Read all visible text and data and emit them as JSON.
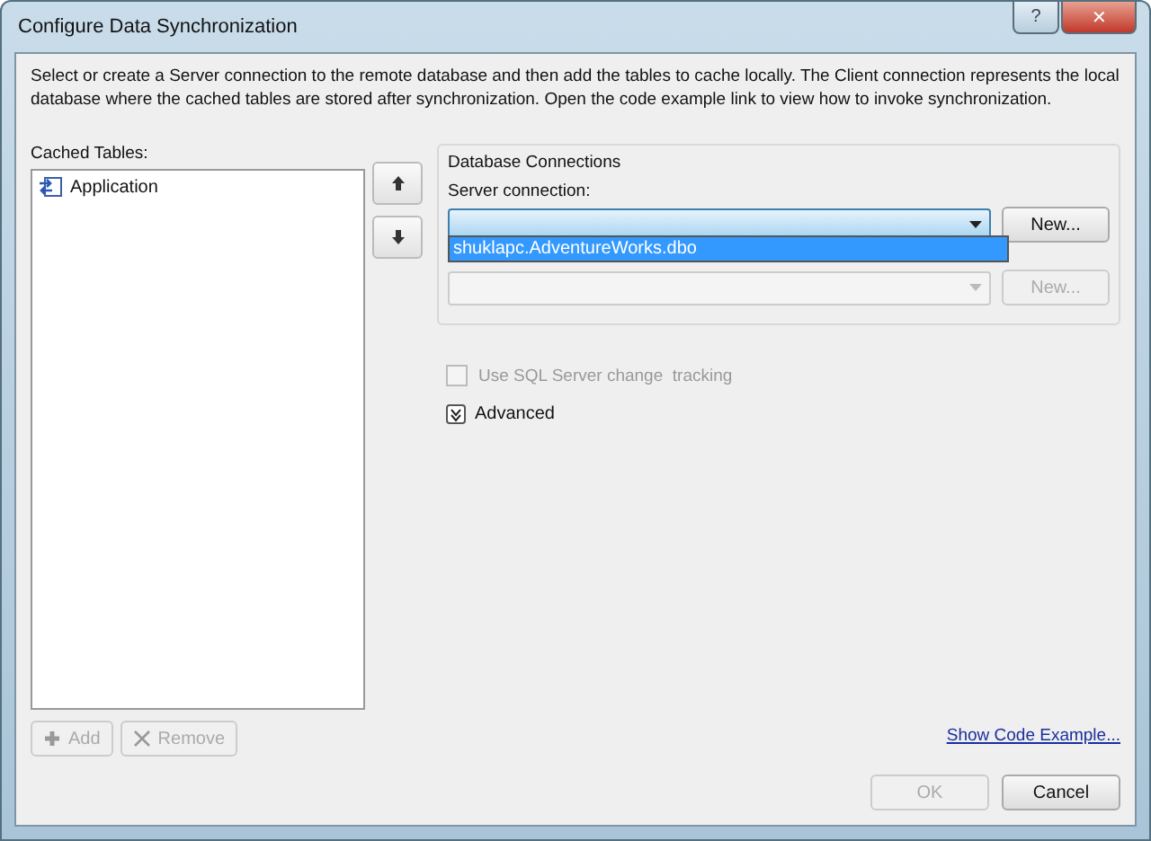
{
  "window": {
    "title": "Configure Data Synchronization",
    "buttons": [
      "?",
      "✕"
    ]
  },
  "description": "Select or create a Server connection to the remote database and then add the tables to cache locally. The Client connection represents the local database where the cached tables are stored after synchronization. Open the code example link to view how to invoke synchronization.",
  "cached_tables": {
    "label": "Cached Tables:",
    "items": [
      {
        "label": "Application",
        "selected": false
      }
    ],
    "buttons": [
      {
        "label": "Add",
        "disabled": true
      },
      {
        "label": "Remove",
        "disabled": true
      }
    ]
  },
  "database_connections": {
    "title": "Database Connections",
    "server_connection": {
      "label": "Server connection:",
      "expanded": true,
      "options": [
        {
          "label": "shuklapc.AdventureWorks.dbo",
          "selected": true
        }
      ],
      "new_button": {
        "label": "New...",
        "disabled": false
      }
    },
    "client_connection": {
      "disabled": true,
      "new_button": {
        "label": "New...",
        "disabled": true
      }
    }
  },
  "change_tracking": {
    "label": "Use SQL Server change  tracking",
    "checked": false,
    "disabled": true
  },
  "advanced": {
    "label": "Advanced",
    "expanded": false
  },
  "link": "Show Code Example...",
  "buttons": [
    {
      "label": "OK",
      "disabled": true
    },
    {
      "label": "Cancel",
      "disabled": false
    }
  ]
}
